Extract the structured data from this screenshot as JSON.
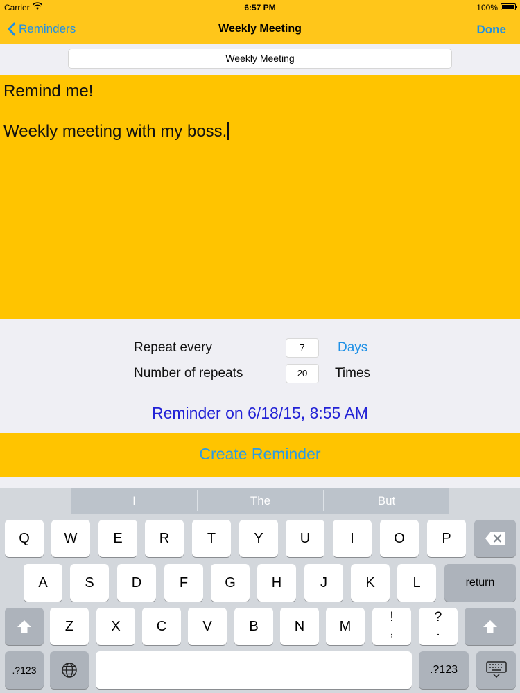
{
  "status": {
    "carrier": "Carrier",
    "time": "6:57 PM",
    "battery": "100%"
  },
  "nav": {
    "back_label": "Reminders",
    "title": "Weekly Meeting",
    "done_label": "Done"
  },
  "title_field": {
    "value": "Weekly Meeting"
  },
  "note": {
    "line1": "Remind me!",
    "line2": "Weekly meeting with my boss."
  },
  "repeat": {
    "label": "Repeat every",
    "value": "7",
    "unit": "Days"
  },
  "repeats": {
    "label": "Number of repeats",
    "value": "20",
    "unit": "Times"
  },
  "reminder_on": "Reminder on 6/18/15, 8:55 AM",
  "create_label": "Create Reminder",
  "suggestions": [
    "I",
    "The",
    "But"
  ],
  "keys": {
    "row1": [
      "Q",
      "W",
      "E",
      "R",
      "T",
      "Y",
      "U",
      "I",
      "O",
      "P"
    ],
    "row2": [
      "A",
      "S",
      "D",
      "F",
      "G",
      "H",
      "J",
      "K",
      "L"
    ],
    "row3": [
      "Z",
      "X",
      "C",
      "V",
      "B",
      "N",
      "M"
    ],
    "excl_top": "!",
    "excl_bottom": ",",
    "ques_top": "?",
    "ques_bottom": ".",
    "return": "return",
    "num_left": ".?123",
    "num_right": ".?123"
  },
  "icons": {
    "back": "chevron-left-icon",
    "wifi": "wifi-icon",
    "battery": "battery-icon",
    "delete": "backspace-icon",
    "shift": "shift-icon",
    "globe": "globe-icon",
    "hide": "keyboard-hide-icon"
  },
  "colors": {
    "bar": "#ffc61a",
    "note": "#ffc400",
    "link": "#1e90e6",
    "reminder": "#2222d6"
  }
}
